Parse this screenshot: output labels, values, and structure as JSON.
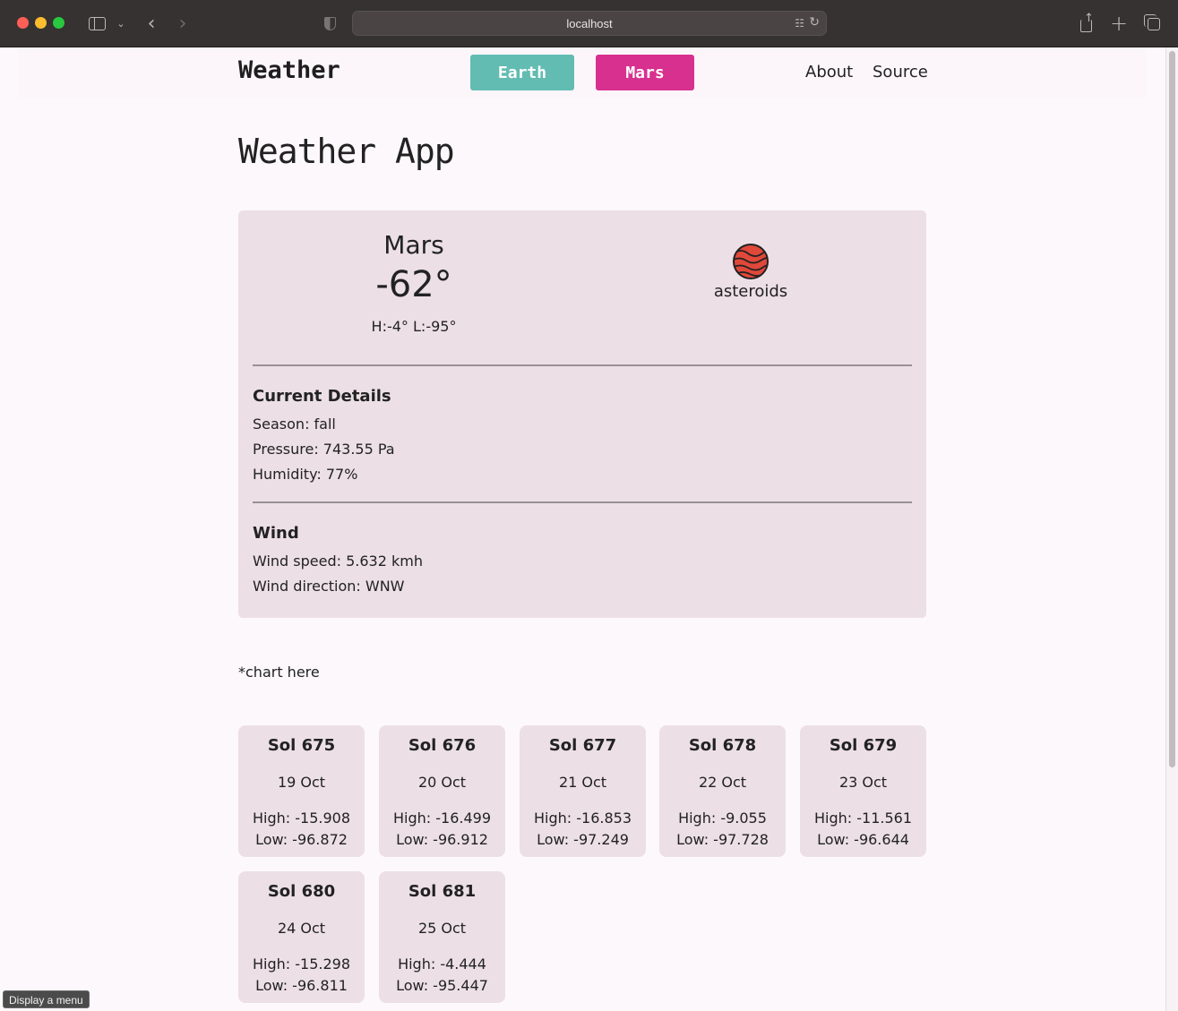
{
  "browser": {
    "url": "localhost",
    "tooltip": "Display a menu"
  },
  "nav": {
    "brand": "Weather",
    "earth_label": "Earth",
    "mars_label": "Mars",
    "about_label": "About",
    "source_label": "Source",
    "colors": {
      "earth": "#63bcb2",
      "mars": "#d8308f"
    }
  },
  "page_title": "Weather App",
  "current": {
    "planet": "Mars",
    "temperature": "-62°",
    "high_low": "H:-4° L:-95°",
    "icon": "mars-planet-icon",
    "condition": "asteroids"
  },
  "details": {
    "title": "Current Details",
    "season": "Season: fall",
    "pressure": "Pressure: 743.55 Pa",
    "humidity": "Humidity: 77%"
  },
  "wind": {
    "title": "Wind",
    "speed": "Wind speed: 5.632 kmh",
    "direction": "Wind direction: WNW"
  },
  "chart_placeholder": "*chart here",
  "sols": [
    {
      "title": "Sol 675",
      "date": "19 Oct",
      "high": "High: -15.908",
      "low": "Low: -96.872"
    },
    {
      "title": "Sol 676",
      "date": "20 Oct",
      "high": "High: -16.499",
      "low": "Low: -96.912"
    },
    {
      "title": "Sol 677",
      "date": "21 Oct",
      "high": "High: -16.853",
      "low": "Low: -97.249"
    },
    {
      "title": "Sol 678",
      "date": "22 Oct",
      "high": "High: -9.055",
      "low": "Low: -97.728"
    },
    {
      "title": "Sol 679",
      "date": "23 Oct",
      "high": "High: -11.561",
      "low": "Low: -96.644"
    },
    {
      "title": "Sol 680",
      "date": "24 Oct",
      "high": "High: -15.298",
      "low": "Low: -96.811"
    },
    {
      "title": "Sol 681",
      "date": "25 Oct",
      "high": "High: -4.444",
      "low": "Low: -95.447"
    }
  ]
}
